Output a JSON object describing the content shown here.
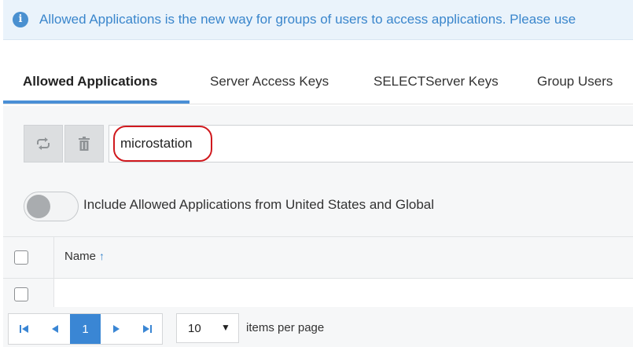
{
  "banner": {
    "icon": "info-icon",
    "text": "Allowed Applications is the new way for groups of users to access applications. Please use"
  },
  "tabs": [
    {
      "label": "Allowed Applications",
      "active": true
    },
    {
      "label": "Server Access Keys",
      "active": false
    },
    {
      "label": "SELECTServer Keys",
      "active": false
    },
    {
      "label": "Group Users",
      "active": false
    }
  ],
  "toolbar": {
    "refresh_icon": "refresh-icon",
    "delete_icon": "trash-icon",
    "search_value": "microstation"
  },
  "toggle": {
    "on": false,
    "label": "Include Allowed Applications from United States and Global"
  },
  "table": {
    "columns": [
      {
        "label": "Name",
        "sort": "ascending"
      }
    ],
    "rows": [
      {
        "name": ""
      }
    ]
  },
  "pager": {
    "current_page": "1",
    "page_size": "10",
    "items_per_page_label": "items per page"
  },
  "colors": {
    "accent": "#3a86d4",
    "banner_bg": "#eaf3fb",
    "banner_text": "#3a86cc",
    "highlight": "#d0191e"
  }
}
